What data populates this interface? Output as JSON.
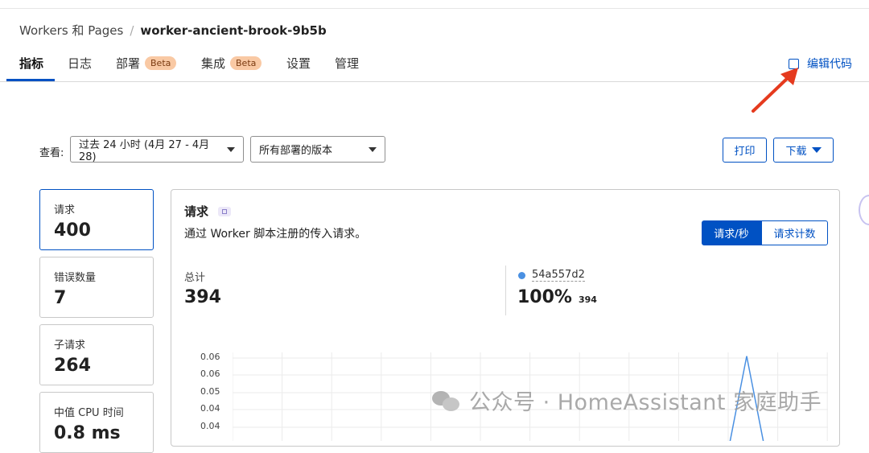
{
  "breadcrumb": {
    "parent": "Workers 和 Pages",
    "separator": "/",
    "current": "worker-ancient-brook-9b5b"
  },
  "tabs": [
    {
      "label": "指标",
      "active": true
    },
    {
      "label": "日志"
    },
    {
      "label": "部署",
      "badge": "Beta"
    },
    {
      "label": "集成",
      "badge": "Beta"
    },
    {
      "label": "设置"
    },
    {
      "label": "管理"
    }
  ],
  "edit_code_label": "编辑代码",
  "toolbar": {
    "view_label": "查看:",
    "time_range": "过去 24 小时 (4月 27 - 4月 28)",
    "versions": "所有部署的版本",
    "print_label": "打印",
    "download_label": "下载"
  },
  "metrics": [
    {
      "label": "请求",
      "value": "400",
      "active": true
    },
    {
      "label": "错误数量",
      "value": "7"
    },
    {
      "label": "子请求",
      "value": "264"
    },
    {
      "label": "中值 CPU 时间",
      "value": "0.8 ms"
    }
  ],
  "panel": {
    "title": "请求",
    "description": "通过 Worker 脚本注册的传入请求。",
    "toggle": {
      "rate": "请求/秒",
      "count": "请求计数"
    },
    "total_label": "总计",
    "total_value": "394",
    "version_name": "54a557d2",
    "version_percent": "100%",
    "version_count": "394"
  },
  "chart_data": {
    "type": "line",
    "y_ticks": [
      "0.06",
      "0.06",
      "0.05",
      "0.04",
      "0.04"
    ],
    "series": [
      {
        "name": "54a557d2",
        "color": "#4a90e2",
        "points": [
          [
            0.0,
            0.0
          ],
          [
            0.86,
            0.0
          ],
          [
            0.9,
            0.063
          ],
          [
            0.94,
            0.0
          ],
          [
            1.0,
            0.0
          ]
        ]
      }
    ]
  },
  "watermark": "公众号 · HomeAssistant 家庭助手",
  "colors": {
    "accent": "#0051c3",
    "badge": "#f9c9a4",
    "arrow": "#e53a1e"
  }
}
